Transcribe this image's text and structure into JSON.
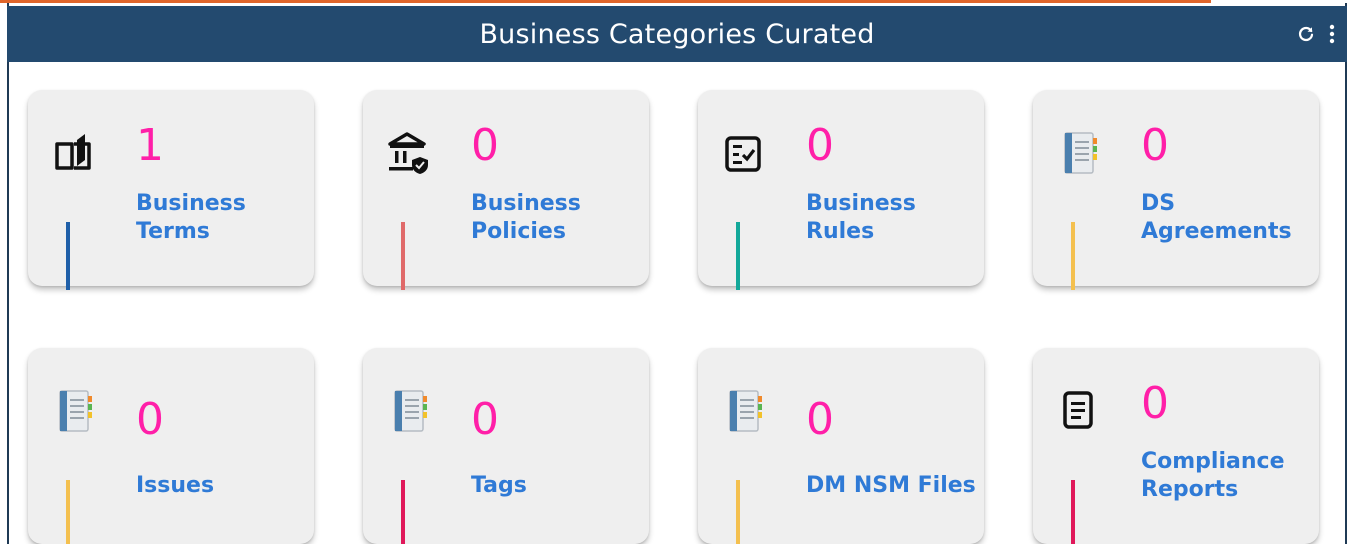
{
  "header": {
    "title": "Business Categories Curated"
  },
  "colors": {
    "header_bg": "#234a6f",
    "count": "#ff1fa8",
    "label": "#2f7ad6"
  },
  "cards": [
    {
      "count": "1",
      "label_lines": [
        "Business",
        "Terms"
      ],
      "icon": "open-book-icon",
      "bar_color": "#1f5fa8"
    },
    {
      "count": "0",
      "label_lines": [
        "Business",
        "Policies"
      ],
      "icon": "bank-shield-icon",
      "bar_color": "#e06a6a"
    },
    {
      "count": "0",
      "label_lines": [
        "Business",
        "Rules"
      ],
      "icon": "checklist-icon",
      "bar_color": "#13a89a"
    },
    {
      "count": "0",
      "label_lines": [
        "DS",
        "Agreements"
      ],
      "icon": "notebook-icon",
      "bar_color": "#f4c04f"
    },
    {
      "count": "0",
      "label_lines": [
        "Issues"
      ],
      "icon": "notebook-icon",
      "bar_color": "#f4c04f"
    },
    {
      "count": "0",
      "label_lines": [
        "Tags"
      ],
      "icon": "notebook-icon",
      "bar_color": "#e0185a"
    },
    {
      "count": "0",
      "label_lines": [
        "DM NSM Files"
      ],
      "icon": "notebook-icon",
      "bar_color": "#f4c04f"
    },
    {
      "count": "0",
      "label_lines": [
        "Compliance",
        "Reports"
      ],
      "icon": "document-icon",
      "bar_color": "#e0185a"
    }
  ]
}
